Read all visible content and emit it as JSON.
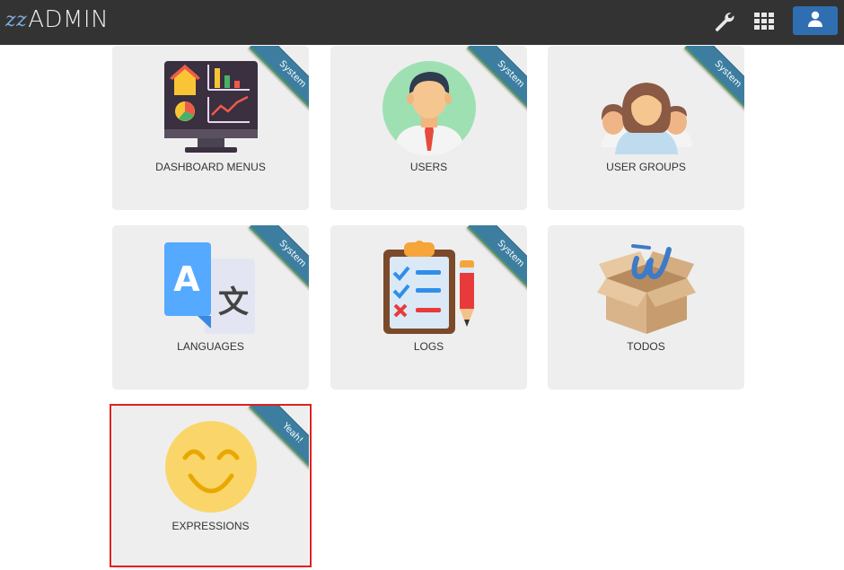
{
  "app": {
    "logo_mark": "zz",
    "logo_word": "ADMIN",
    "accent": "#2f6fb1",
    "topbar_color": "#333333"
  },
  "header": {
    "tools_icon": "wrench-icon",
    "apps_icon": "apps-grid-icon",
    "user_icon": "user-icon"
  },
  "tiles": [
    {
      "label": "DASHBOARD MENUS",
      "ribbon": "System",
      "icon": "dashboard-monitor-icon"
    },
    {
      "label": "USERS",
      "ribbon": "System",
      "icon": "user-avatar-icon"
    },
    {
      "label": "USER GROUPS",
      "ribbon": "System",
      "icon": "user-groups-icon"
    },
    {
      "label": "LANGUAGES",
      "ribbon": "System",
      "icon": "translate-icon"
    },
    {
      "label": "LOGS",
      "ribbon": "System",
      "icon": "clipboard-checklist-icon"
    },
    {
      "label": "TODOS",
      "ribbon": "",
      "icon": "box-icon"
    },
    {
      "label": "EXPRESSIONS",
      "ribbon": "Yeah!",
      "icon": "smiley-face-icon"
    }
  ],
  "ribbon_color": "#3d7ea0",
  "tile_background": "#eeeeee",
  "selection_color": "#e02020"
}
